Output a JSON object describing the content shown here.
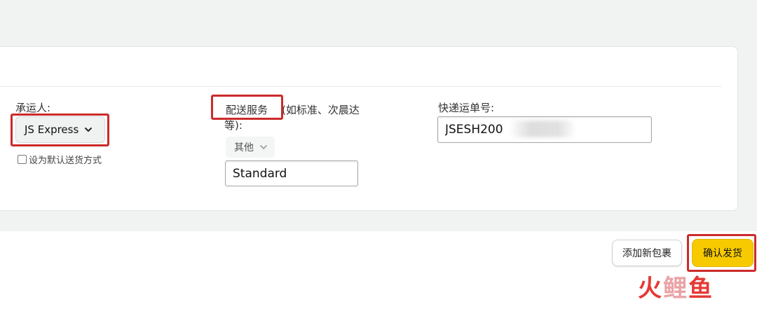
{
  "carrier": {
    "label": "承运人:",
    "selected": "JS Express",
    "default_checkbox_label": "设为默认送货方式"
  },
  "service": {
    "label_highlight": "配送服务",
    "label_rest_line1": "(如标准、次晨达",
    "label_rest_line2": "等):",
    "selected": "其他",
    "input_value": "Standard"
  },
  "tracking": {
    "label": "快递运单号:",
    "input_value": "JSESH200"
  },
  "actions": {
    "add_package": "添加新包裹",
    "confirm_ship": "确认发货"
  },
  "watermark": {
    "text_1": "火",
    "text_2": "鲤",
    "text_3": "鱼"
  },
  "colors": {
    "highlight_red": "#cc2a2a",
    "primary_yellow": "#f7ca00"
  }
}
